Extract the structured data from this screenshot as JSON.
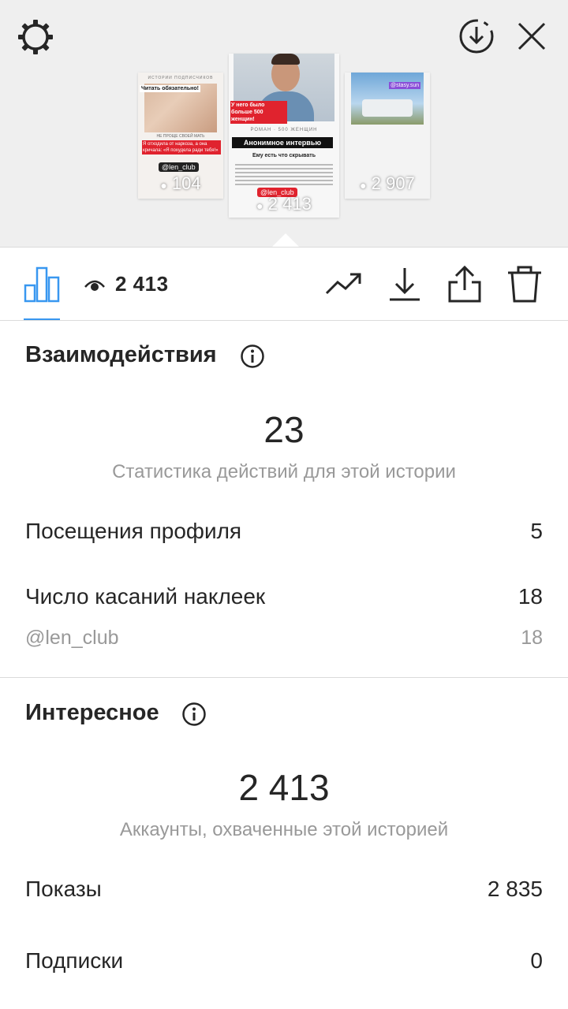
{
  "stories": {
    "left": {
      "header": "ИСТОРИИ ПОДПИСЧИКОВ",
      "badge": "Читать обязательно!",
      "sub": "НЕ ПРОЩЕ СВОЕЙ МАТЬ",
      "headline": "Я отходила от наркоза, а она кричала: «Я похудела ради тебя!»",
      "tag": "@len_club",
      "views": "104"
    },
    "center": {
      "badge": "У него было больше 500 женщин!",
      "byline": "РОМАН · 500 ЖЕНЩИН",
      "title": "Анонимное интервью",
      "subtitle": "Ему есть что скрывать",
      "tag": "@len_club",
      "views": "2 413"
    },
    "right": {
      "tag": "@stasy.sun",
      "views": "2 907"
    }
  },
  "toolbar": {
    "views": "2 413"
  },
  "interactions": {
    "title": "Взаимодействия",
    "total": "23",
    "caption": "Статистика действий для этой истории",
    "rows": [
      {
        "label": "Посещения профиля",
        "value": "5"
      },
      {
        "label": "Число касаний наклеек",
        "value": "18"
      },
      {
        "label": "@len_club",
        "value": "18"
      }
    ]
  },
  "discovery": {
    "title": "Интересное",
    "total": "2 413",
    "caption": "Аккаунты, охваченные этой историей",
    "rows": [
      {
        "label": "Показы",
        "value": "2 835"
      },
      {
        "label": "Подписки",
        "value": "0"
      }
    ]
  },
  "colors": {
    "accent": "#3897f0",
    "top_bg": "#efefef",
    "muted": "#999999",
    "red": "#e0232e"
  },
  "icons": [
    "gear-icon",
    "download-circle-icon",
    "close-icon",
    "bar-chart-icon",
    "eye-icon",
    "trending-icon",
    "download-icon",
    "share-icon",
    "trash-icon",
    "info-icon"
  ]
}
